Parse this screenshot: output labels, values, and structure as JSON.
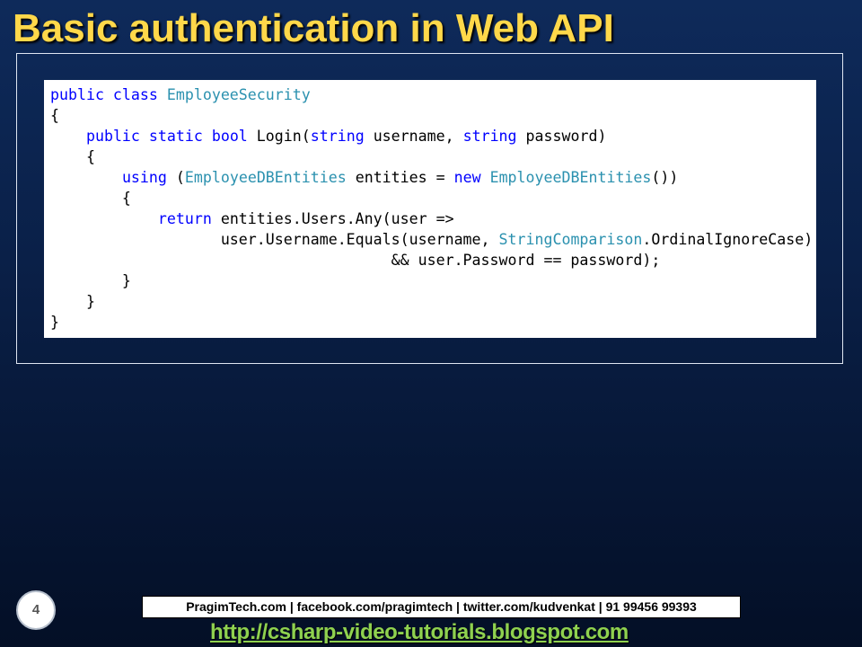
{
  "slide": {
    "title": "Basic authentication in Web API",
    "page_number": "4"
  },
  "code": {
    "lines": [
      [
        {
          "t": "public class ",
          "c": "kw"
        },
        {
          "t": "EmployeeSecurity",
          "c": "ty"
        }
      ],
      [
        {
          "t": "{",
          "c": ""
        }
      ],
      [
        {
          "t": "    ",
          "c": ""
        },
        {
          "t": "public static bool ",
          "c": "kw"
        },
        {
          "t": "Login(",
          "c": ""
        },
        {
          "t": "string ",
          "c": "kw"
        },
        {
          "t": "username, ",
          "c": ""
        },
        {
          "t": "string ",
          "c": "kw"
        },
        {
          "t": "password)",
          "c": ""
        }
      ],
      [
        {
          "t": "    {",
          "c": ""
        }
      ],
      [
        {
          "t": "        ",
          "c": ""
        },
        {
          "t": "using ",
          "c": "kw"
        },
        {
          "t": "(",
          "c": ""
        },
        {
          "t": "EmployeeDBEntities",
          "c": "ty"
        },
        {
          "t": " entities = ",
          "c": ""
        },
        {
          "t": "new ",
          "c": "kw"
        },
        {
          "t": "EmployeeDBEntities",
          "c": "ty"
        },
        {
          "t": "())",
          "c": ""
        }
      ],
      [
        {
          "t": "        {",
          "c": ""
        }
      ],
      [
        {
          "t": "            ",
          "c": ""
        },
        {
          "t": "return ",
          "c": "kw"
        },
        {
          "t": "entities.Users.Any(user =>",
          "c": ""
        }
      ],
      [
        {
          "t": "                   user.Username.Equals(username, ",
          "c": ""
        },
        {
          "t": "StringComparison",
          "c": "ty"
        },
        {
          "t": ".OrdinalIgnoreCase)",
          "c": ""
        }
      ],
      [
        {
          "t": "                                      && user.Password == password);",
          "c": ""
        }
      ],
      [
        {
          "t": "        }",
          "c": ""
        }
      ],
      [
        {
          "t": "    }",
          "c": ""
        }
      ],
      [
        {
          "t": "}",
          "c": ""
        }
      ]
    ]
  },
  "footer": {
    "links": "PragimTech.com | facebook.com/pragimtech  | twitter.com/kudvenkat  | 91 99456 99393",
    "url": "http://csharp-video-tutorials.blogspot.com"
  },
  "colors": {
    "title": "#ffd84a",
    "keyword": "#0000ff",
    "type": "#2b91af",
    "url": "#8fd14f"
  }
}
